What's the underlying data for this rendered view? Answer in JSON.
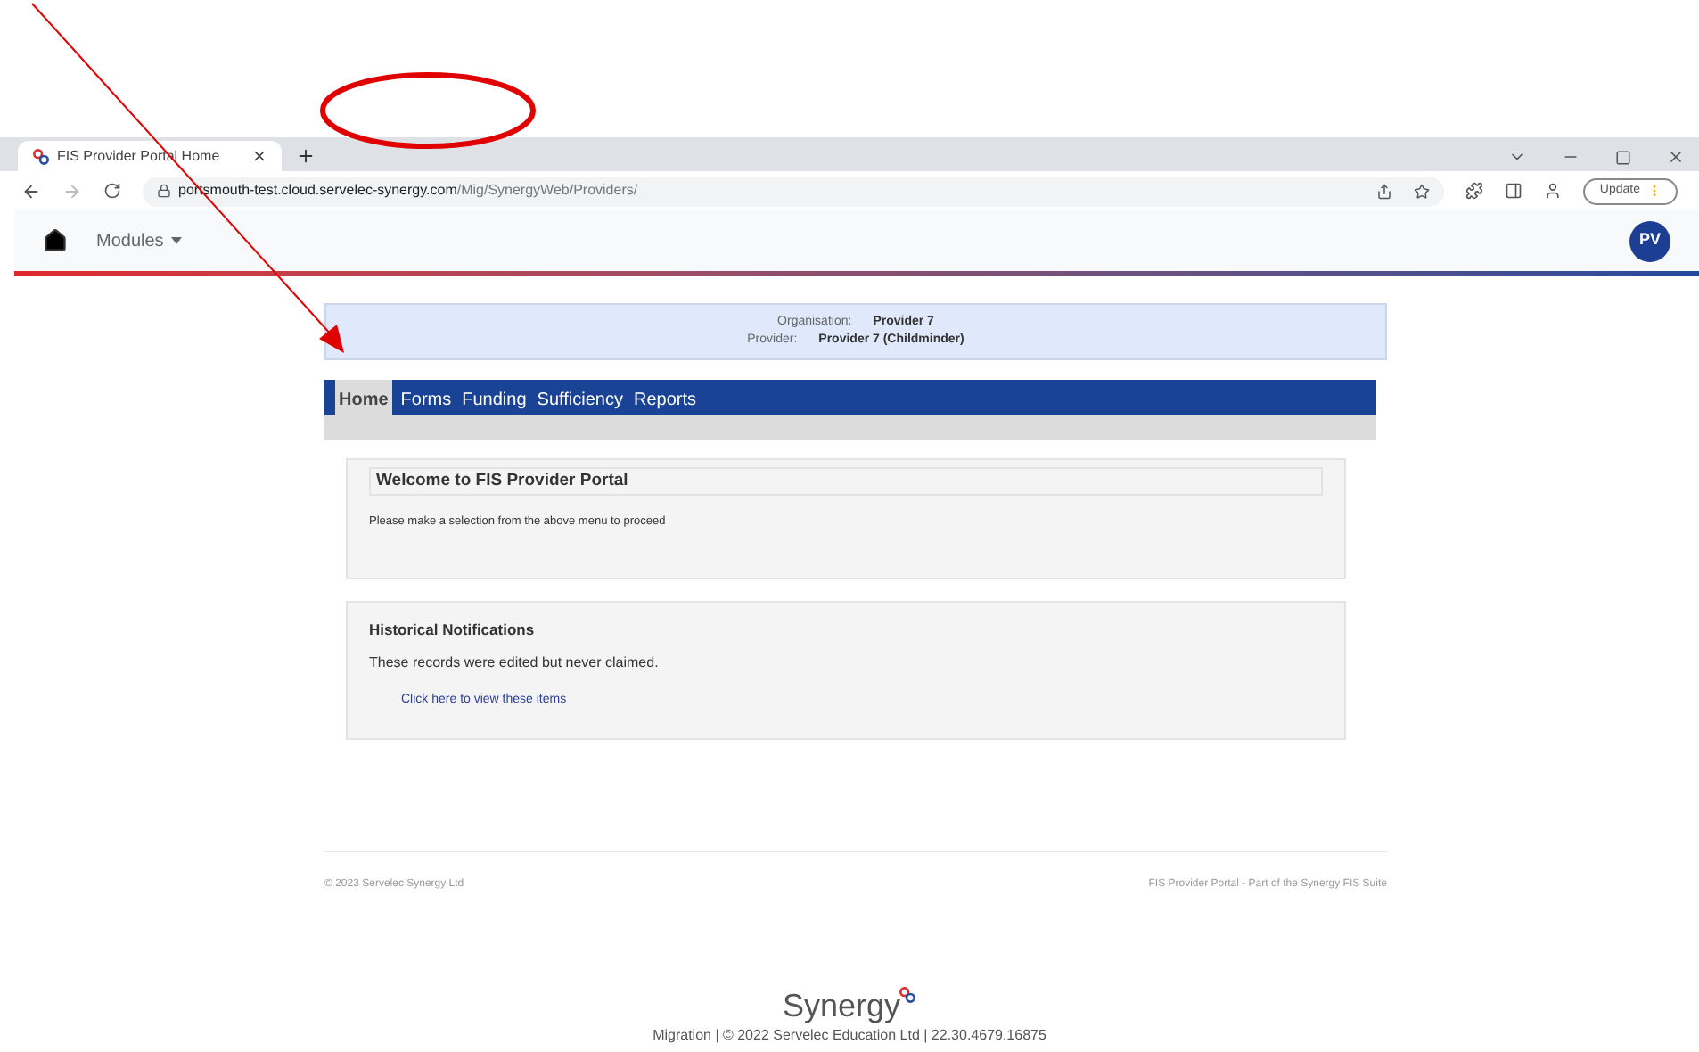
{
  "browser": {
    "tab_title": "FIS Provider Portal Home",
    "url_host": "portsmouth-test.cloud.servelec-synergy.com",
    "url_path": "/Mig/SynergyWeb/Providers/",
    "update_label": "Update"
  },
  "app_nav": {
    "modules_label": "Modules",
    "avatar_initials": "PV"
  },
  "info": [
    {
      "label": "Organisation:",
      "value": "Provider 7"
    },
    {
      "label": "Provider:",
      "value": "Provider 7 (Childminder)"
    }
  ],
  "menu": [
    {
      "label": "Home",
      "selected": true
    },
    {
      "label": "Forms",
      "selected": false
    },
    {
      "label": "Funding",
      "selected": false
    },
    {
      "label": "Sufficiency",
      "selected": false
    },
    {
      "label": "Reports",
      "selected": false
    }
  ],
  "welcome": {
    "title": "Welcome to FIS Provider Portal",
    "text": "Please make a selection from the above menu to proceed"
  },
  "notifications": {
    "title": "Historical Notifications",
    "text": "These records were edited but never claimed.",
    "link": "Click here to view these items"
  },
  "footer": {
    "left": "© 2023 Servelec Synergy Ltd",
    "right": "FIS Provider Portal - Part of the Synergy FIS Suite"
  },
  "bottom": {
    "logo_text": "Synergy",
    "version": "Migration | © 2022 Servelec Education Ltd | 22.30.4679.16875"
  }
}
